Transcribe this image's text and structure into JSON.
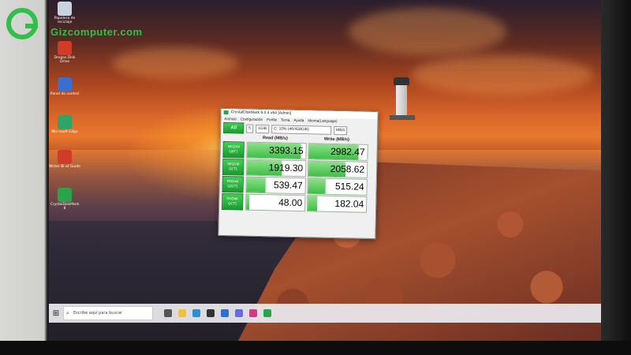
{
  "watermark": {
    "brand": "Gizcomputer.com"
  },
  "desktop_icons": [
    {
      "label": "Papelera de reciclaje",
      "icon": "recycle-bin-icon",
      "color": "#c8d2e0"
    },
    {
      "label": "Drogas Disk Drive",
      "icon": "pdf-file-icon",
      "color": "#d23a2a"
    },
    {
      "label": "Panel de control",
      "icon": "control-panel-icon",
      "color": "#3a6fd0"
    },
    {
      "label": "Microsoft Edge",
      "icon": "edge-icon",
      "color": "#2fa56a"
    },
    {
      "label": "Writer Bi of Guide",
      "icon": "pdf-file-icon",
      "color": "#d23a2a"
    },
    {
      "label": "CrystalDiskMark 8",
      "icon": "crystaldiskmark-icon",
      "color": "#2aa34a"
    }
  ],
  "cdm": {
    "title": "CrystalDiskMark 8.0.4 x64 [Admin]",
    "menu": [
      "Archivo",
      "Configuración",
      "Perfile",
      "Tema",
      "Ayuda",
      "Idioma(Language)"
    ],
    "all_label": "All",
    "runs": "5",
    "size": "1GiB",
    "drive": "C: 10% (46/458GiB)",
    "unit": "MB/s",
    "read_header": "Read (MB/s)",
    "write_header": "Write (MB/s)",
    "rows": [
      {
        "l1": "SEQ1M",
        "l2": "Q8T1",
        "read": "3393.15",
        "write": "2982.47",
        "read_frac": 0.92,
        "write_frac": 0.85
      },
      {
        "l1": "SEQ1M",
        "l2": "Q1T1",
        "read": "1919.30",
        "write": "2058.62",
        "read_frac": 0.6,
        "write_frac": 0.64
      },
      {
        "l1": "RND4K",
        "l2": "Q32T1",
        "read": "539.47",
        "write": "515.24",
        "read_frac": 0.32,
        "write_frac": 0.3
      },
      {
        "l1": "RND4K",
        "l2": "Q1T1",
        "read": "48.00",
        "write": "182.04",
        "read_frac": 0.06,
        "write_frac": 0.16
      }
    ]
  },
  "taskbar": {
    "search_placeholder": "Escribe aquí para buscar",
    "apps": [
      {
        "icon": "task-view-icon",
        "color": "#555"
      },
      {
        "icon": "explorer-icon",
        "color": "#f0c040"
      },
      {
        "icon": "edge-icon",
        "color": "#2f8fd0"
      },
      {
        "icon": "store-icon",
        "color": "#333"
      },
      {
        "icon": "mail-icon",
        "color": "#2f6fd0"
      },
      {
        "icon": "photos-icon",
        "color": "#6a6adf"
      },
      {
        "icon": "app-icon",
        "color": "#d03a8a"
      },
      {
        "icon": "crystaldiskmark-icon",
        "color": "#2aa34a"
      }
    ]
  }
}
